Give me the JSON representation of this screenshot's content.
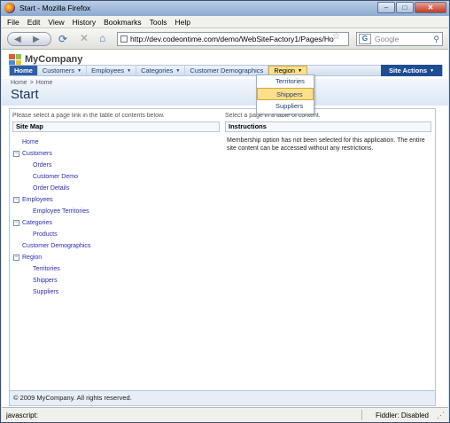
{
  "window": {
    "title": "Start - Mozilla Firefox"
  },
  "menubar": [
    "File",
    "Edit",
    "View",
    "History",
    "Bookmarks",
    "Tools",
    "Help"
  ],
  "navbar": {
    "url": "http://dev.codeontime.com/demo/WebSiteFactory1/Pages/Ho",
    "search_placeholder": "Google"
  },
  "site": {
    "brand": "MyCompany",
    "menu": [
      {
        "label": "Home",
        "dropdown": false
      },
      {
        "label": "Customers",
        "dropdown": true
      },
      {
        "label": "Employees",
        "dropdown": true
      },
      {
        "label": "Categories",
        "dropdown": true
      },
      {
        "label": "Customer Demographics",
        "dropdown": false
      },
      {
        "label": "Region",
        "dropdown": true
      }
    ],
    "site_actions": "Site Actions",
    "region_menu": [
      "Territories",
      "Shippers",
      "Suppliers"
    ],
    "region_menu_highlighted": "Shippers"
  },
  "breadcrumb": {
    "home": "Home",
    "sep": ">",
    "current": "Home"
  },
  "page_title": "Start",
  "left": {
    "note": "Please select a page link in the table of contents below.",
    "header": "Site Map",
    "tree": [
      {
        "label": "Home",
        "level": 0,
        "expander": ""
      },
      {
        "label": "Customers",
        "level": 0,
        "expander": "−"
      },
      {
        "label": "Orders",
        "level": 1,
        "expander": ""
      },
      {
        "label": "Customer Demo",
        "level": 1,
        "expander": ""
      },
      {
        "label": "Order Details",
        "level": 1,
        "expander": ""
      },
      {
        "label": "Employees",
        "level": 0,
        "expander": "−"
      },
      {
        "label": "Employee Territories",
        "level": 1,
        "expander": ""
      },
      {
        "label": "Categories",
        "level": 0,
        "expander": "−"
      },
      {
        "label": "Products",
        "level": 1,
        "expander": ""
      },
      {
        "label": "Customer Demographics",
        "level": 0,
        "expander": ""
      },
      {
        "label": "Region",
        "level": 0,
        "expander": "−"
      },
      {
        "label": "Territories",
        "level": 1,
        "expander": ""
      },
      {
        "label": "Shippers",
        "level": 1,
        "expander": ""
      },
      {
        "label": "Suppliers",
        "level": 1,
        "expander": ""
      }
    ]
  },
  "right": {
    "note": "Select a page in a table of content.",
    "header": "Instructions",
    "text": "Membership option has not been selected for this application. The entire site content can be accessed without any restrictions."
  },
  "footer": "© 2009 MyCompany. All rights reserved.",
  "status": {
    "left": "javascript:",
    "right": "Fiddler: Disabled"
  },
  "colors": {
    "accent": "#2e5fa7",
    "highlight": "#ffe08a",
    "link": "#2b2bb3"
  }
}
